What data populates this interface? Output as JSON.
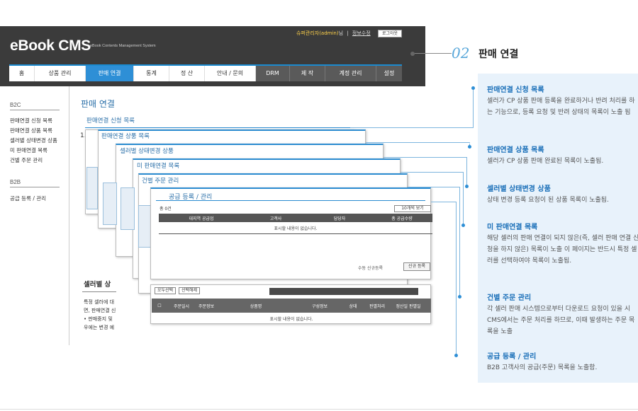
{
  "header": {
    "logo": "eBook CMS",
    "logo_sub": "eBook Contents Management System",
    "user_admin": "슈퍼관리자(admin)",
    "user_suffix": "님",
    "separator": "|",
    "edit_info": "정보수정",
    "logout": "로그아웃"
  },
  "nav": [
    {
      "label": "홈"
    },
    {
      "label": "상품 관리"
    },
    {
      "label": "판매 연결"
    },
    {
      "label": "통계"
    },
    {
      "label": "정 산"
    },
    {
      "label": "안내 / 문의"
    },
    {
      "label": "DRM"
    },
    {
      "label": "제 작"
    },
    {
      "label": "계정 관리"
    },
    {
      "label": "설정"
    }
  ],
  "annotation": {
    "number": "02",
    "title": "판매 연결"
  },
  "sidebar": {
    "b2c_head": "B2C",
    "b2c_items": [
      "판매연결 신청 목록",
      "판매연결 상품 목록",
      "셀러별 상태변경 상품",
      "미 판매연결 목록",
      "건별 주문 관리"
    ],
    "b2b_head": "B2B",
    "b2b_items": [
      "공급 등록 / 관리"
    ]
  },
  "main": {
    "title": "판매 연결",
    "stack": [
      "판매연결 신청 목록",
      "판매연결 상품 목록",
      "셀러별 상태변경 상품",
      "미 판매연결 목록",
      "건별 주문 관리",
      "공급 등록 / 관리"
    ],
    "top_panel": {
      "total": "총 0건",
      "per_page": "10개씩 보기",
      "columns": [
        "대지역 공급업",
        "고객사",
        "담당자",
        "총 공급수량"
      ],
      "empty": "표시할 내용이 없습니다.",
      "register_hint": "수동 신규등록",
      "register_btn": "신규 등록"
    },
    "bottom_panel": {
      "btn_all": "오두선택",
      "btn_del": "선택해제",
      "columns": [
        "",
        "주문일시",
        "주문정보",
        "상품명",
        "구성정보",
        "상태",
        "판별처리",
        "정산일 판별일"
      ],
      "empty": "표시할 내용이 없습니다."
    },
    "seller_heading": "셀러별 상",
    "seller_text": [
      "특정 셀러에 대",
      "면, 판매연결 신",
      "• 판매중지 및",
      "우에는 변경 예"
    ]
  },
  "descriptions": [
    {
      "title": "판매연결 신청 목록",
      "text": "셀러가 CP 상품 판매 등록을 완료하거나 반려 처리를 하는 기능으로, 등록 요청 및 반려 상태의 목록이 노출 됨"
    },
    {
      "title": "판매연결 상품 목록",
      "text": "셀러가 CP 상품 판매 완료된 목록이 노출됨."
    },
    {
      "title": "셀러별 상태변경 상품",
      "text": "상태 변경 등록 요청이 된 상품 목록이 노출됨."
    },
    {
      "title": "미 판매연결 목록",
      "text": "해당 셀러의 판매 연결이 되지 않은(즉, 셀러 판매 연결 신청을 하지 않은) 목록이 노출 이 페이지는 반드시 특정 셀러를 선택하여야 목록이 노출됨."
    },
    {
      "title": "건별 주문 관리",
      "text": "각 셀러 판매 시스템으로부터 다운로드 요청이 있을 시 CMS에서는 주문 처리를 하므로, 이때 발생하는 주문 목록을 노출"
    },
    {
      "title": "공급 등록 / 관리",
      "text": "B2B 고객사의 공급(주문) 목록을 노출함."
    }
  ],
  "colors": {
    "accent": "#2e8fd6",
    "header_bg": "#3b3b3b",
    "desc_bg": "#e8f2fb",
    "title_blue": "#1a6fb8"
  }
}
